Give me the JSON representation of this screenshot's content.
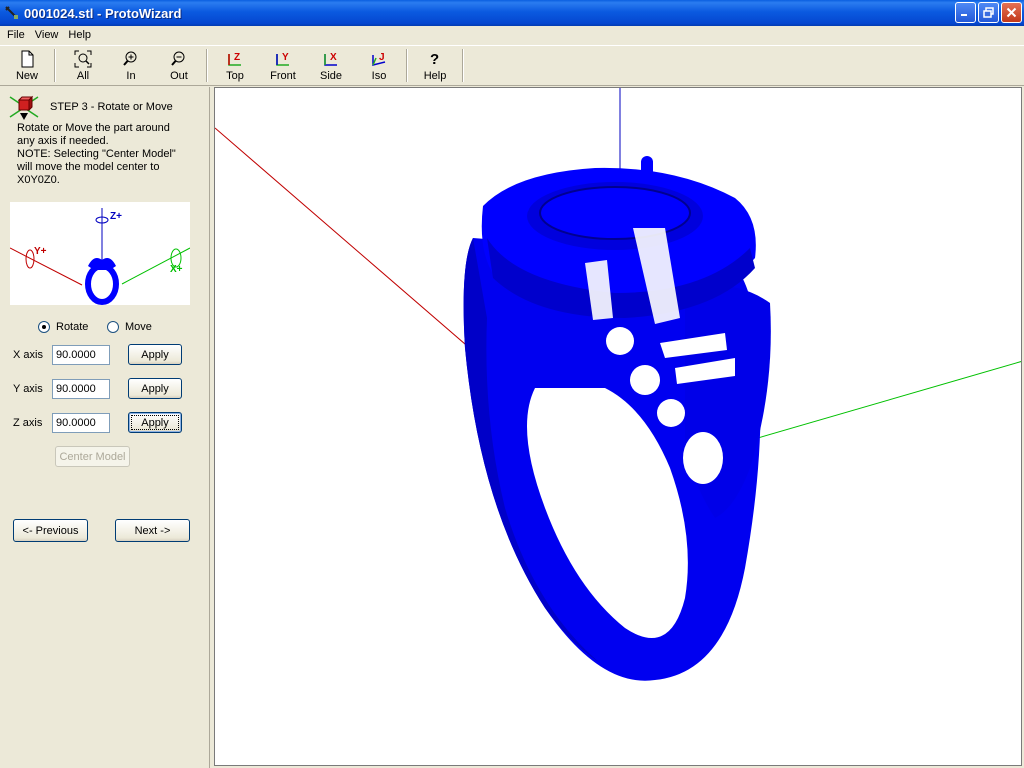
{
  "window": {
    "title": "0001024.stl - ProtoWizard",
    "minimize_icon": "minimize-icon",
    "maximize_icon": "restore-icon",
    "close_icon": "close-icon"
  },
  "menu": [
    "File",
    "View",
    "Help"
  ],
  "toolbar": {
    "new_label": "New",
    "all_label": "All",
    "in_label": "In",
    "out_label": "Out",
    "top_label": "Top",
    "front_label": "Front",
    "side_label": "Side",
    "iso_label": "Iso",
    "help_label": "Help",
    "top_icon_text": "Z",
    "front_icon_text": "Y",
    "side_icon_text": "X",
    "iso_icon_text": "J",
    "help_icon_text": "?"
  },
  "step": {
    "title": "STEP 3 - Rotate or Move",
    "description": "Rotate or Move the part around\nany axis if needed.\nNOTE: Selecting \"Center Model\"\nwill move the model center to\nX0Y0Z0."
  },
  "diagram": {
    "z_label": "Z+",
    "y_label": "Y+",
    "x_label": "X+"
  },
  "mode": {
    "rotate_label": "Rotate",
    "move_label": "Move",
    "selected": "Rotate"
  },
  "axes": {
    "x_label": "X axis",
    "x_value": "90.0000",
    "y_label": "Y axis",
    "y_value": "90.0000",
    "z_label": "Z axis",
    "z_value": "90.0000",
    "apply_label": "Apply"
  },
  "buttons": {
    "center_model": "Center Model",
    "previous": "<- Previous",
    "next": "Next ->"
  },
  "colors": {
    "model": "#0000ff",
    "x_axis": "#00c000",
    "y_axis": "#c00000",
    "z_axis": "#0000ff"
  }
}
